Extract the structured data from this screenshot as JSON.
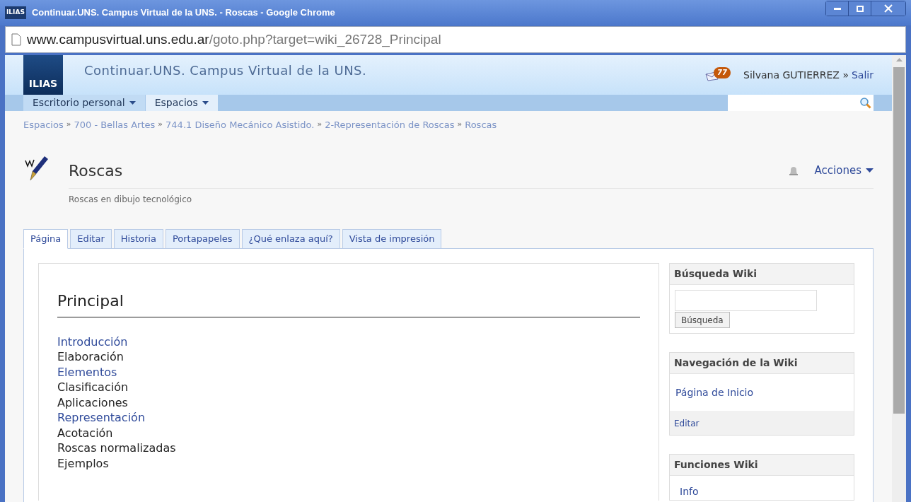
{
  "window": {
    "title": "Continuar.UNS. Campus Virtual de la UNS. - Roscas - Google Chrome",
    "app_icon": "ILIAS"
  },
  "address": {
    "host": "www.campusvirtual.uns.edu.ar",
    "path": "/goto.php?target=wiki_26728_Principal"
  },
  "header": {
    "logo": "ILIAS",
    "site_title": "Continuar.UNS. Campus Virtual de la UNS.",
    "mail_count": "77",
    "user": "Silvana GUTIERREZ",
    "separator": "»",
    "logout": "Salir"
  },
  "nav": [
    {
      "label": "Escritorio personal",
      "selected": false
    },
    {
      "label": "Espacios",
      "selected": true
    }
  ],
  "breadcrumb": [
    "Espacios",
    "700 - Bellas Artes",
    "744.1 Diseño Mecánico Asistido.",
    "2-Representación de Roscas",
    "Roscas"
  ],
  "object": {
    "title": "Roscas",
    "description": "Roscas en dibujo tecnológico",
    "actions": "Acciones"
  },
  "tabs": [
    {
      "label": "Página",
      "selected": true
    },
    {
      "label": "Editar",
      "selected": false
    },
    {
      "label": "Historia",
      "selected": false
    },
    {
      "label": "Portapapeles",
      "selected": false
    },
    {
      "label": "¿Qué enlaza aquí?",
      "selected": false
    },
    {
      "label": "Vista de impresión",
      "selected": false
    }
  ],
  "page": {
    "heading": "Principal",
    "items": [
      {
        "text": "Introducción",
        "kind": "link"
      },
      {
        "text": "Elaboración",
        "kind": "text"
      },
      {
        "text": "Elementos",
        "kind": "link"
      },
      {
        "text": "Clasificación",
        "kind": "text"
      },
      {
        "text": "Aplicaciones",
        "kind": "text"
      },
      {
        "text": "Representación",
        "kind": "link"
      },
      {
        "text": "Acotación",
        "kind": "text"
      },
      {
        "text": "Roscas normalizadas",
        "kind": "text"
      },
      {
        "text": "Ejemplos",
        "kind": "text"
      }
    ]
  },
  "sidebar": {
    "search": {
      "title": "Búsqueda Wiki",
      "button": "Búsqueda"
    },
    "navigation": {
      "title": "Navegación de la Wiki",
      "link": "Página de Inicio",
      "edit": "Editar"
    },
    "functions": {
      "title": "Funciones Wiki",
      "items": [
        "Info"
      ]
    }
  }
}
